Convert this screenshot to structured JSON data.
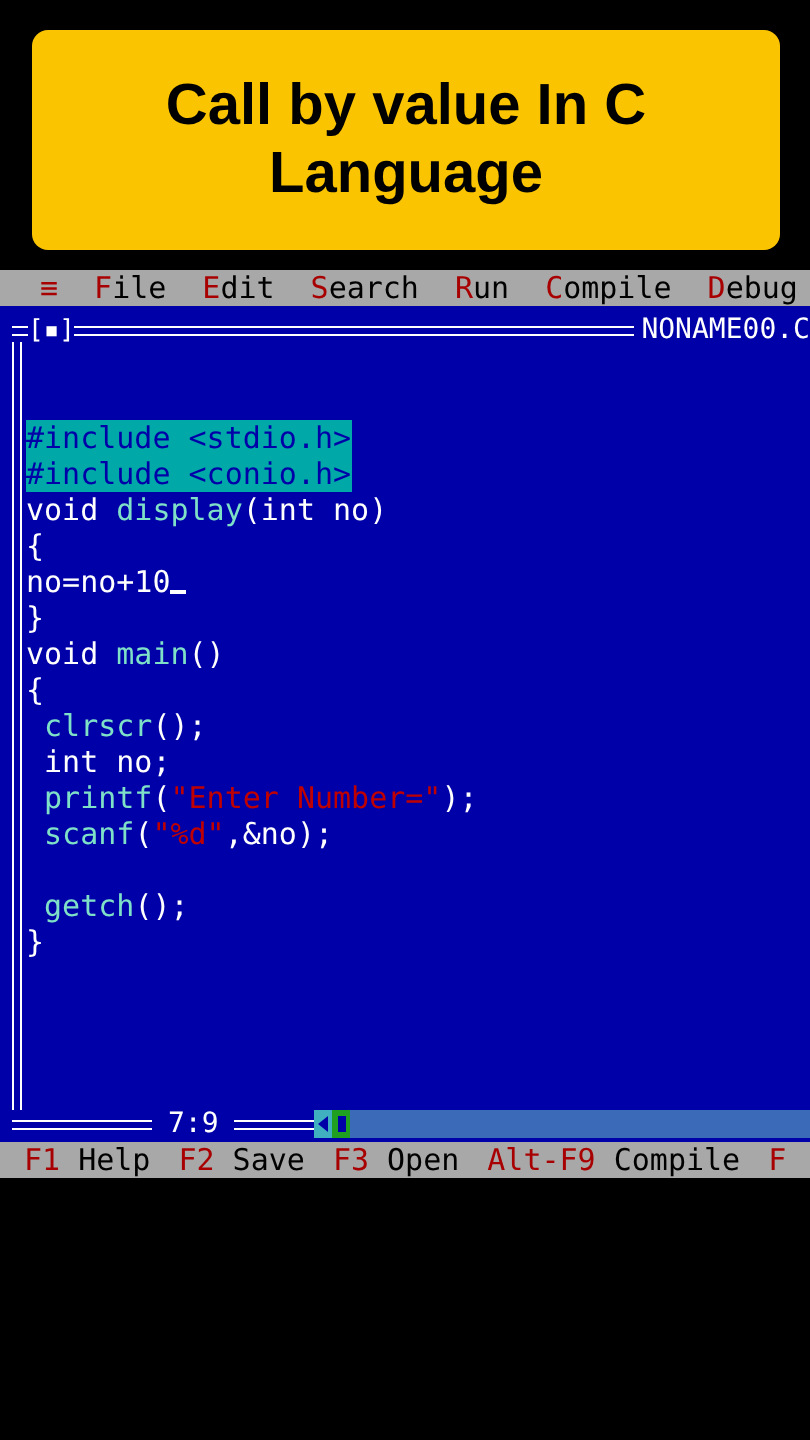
{
  "banner": {
    "title": "Call by value In C Language"
  },
  "menu": [
    {
      "hotkey": "≡"
    },
    {
      "hotkey": "F",
      "rest": "ile"
    },
    {
      "hotkey": "E",
      "rest": "dit"
    },
    {
      "hotkey": "S",
      "rest": "earch"
    },
    {
      "hotkey": "R",
      "rest": "un"
    },
    {
      "hotkey": "C",
      "rest": "ompile"
    },
    {
      "hotkey": "D",
      "rest": "ebug"
    }
  ],
  "editor": {
    "window_marker": "[▪]",
    "filename": "NONAME00.C",
    "cursor_position": "7:9",
    "lines": [
      {
        "kind": "blank"
      },
      {
        "kind": "blank"
      },
      {
        "kind": "code",
        "segments": [
          {
            "kind": "selected",
            "text": "#include <stdio.h>"
          }
        ]
      },
      {
        "kind": "code",
        "segments": [
          {
            "kind": "selected",
            "text": "#include <conio.h>"
          }
        ]
      },
      {
        "kind": "code",
        "segments": [
          {
            "kind": "plain",
            "text": "void "
          },
          {
            "kind": "func",
            "text": "display"
          },
          {
            "kind": "plain",
            "text": "(int no)"
          }
        ]
      },
      {
        "kind": "code",
        "segments": [
          {
            "kind": "plain",
            "text": "{"
          }
        ]
      },
      {
        "kind": "code",
        "segments": [
          {
            "kind": "plain",
            "text": "no=no+10"
          }
        ],
        "cursor": true
      },
      {
        "kind": "code",
        "segments": [
          {
            "kind": "plain",
            "text": "}"
          }
        ]
      },
      {
        "kind": "code",
        "segments": [
          {
            "kind": "plain",
            "text": "void "
          },
          {
            "kind": "func",
            "text": "main"
          },
          {
            "kind": "plain",
            "text": "()"
          }
        ]
      },
      {
        "kind": "code",
        "segments": [
          {
            "kind": "plain",
            "text": "{"
          }
        ]
      },
      {
        "kind": "code",
        "segments": [
          {
            "kind": "func",
            "text": " clrscr"
          },
          {
            "kind": "plain",
            "text": "();"
          }
        ]
      },
      {
        "kind": "code",
        "segments": [
          {
            "kind": "plain",
            "text": " int no;"
          }
        ]
      },
      {
        "kind": "code",
        "segments": [
          {
            "kind": "func",
            "text": " printf"
          },
          {
            "kind": "plain",
            "text": "("
          },
          {
            "kind": "string",
            "text": "\"Enter Number=\""
          },
          {
            "kind": "plain",
            "text": ");"
          }
        ]
      },
      {
        "kind": "code",
        "segments": [
          {
            "kind": "func",
            "text": " scanf"
          },
          {
            "kind": "plain",
            "text": "("
          },
          {
            "kind": "string",
            "text": "\"%d\""
          },
          {
            "kind": "plain",
            "text": ",&no);"
          }
        ]
      },
      {
        "kind": "blank"
      },
      {
        "kind": "code",
        "segments": [
          {
            "kind": "func",
            "text": " getch"
          },
          {
            "kind": "plain",
            "text": "();"
          }
        ]
      },
      {
        "kind": "code",
        "segments": [
          {
            "kind": "plain",
            "text": "}"
          }
        ]
      }
    ]
  },
  "status_bar": [
    {
      "key": "F1",
      "label": "Help"
    },
    {
      "key": "F2",
      "label": "Save"
    },
    {
      "key": "F3",
      "label": "Open"
    },
    {
      "key": "Alt-F9",
      "label": "Compile"
    },
    {
      "key": "F"
    }
  ]
}
